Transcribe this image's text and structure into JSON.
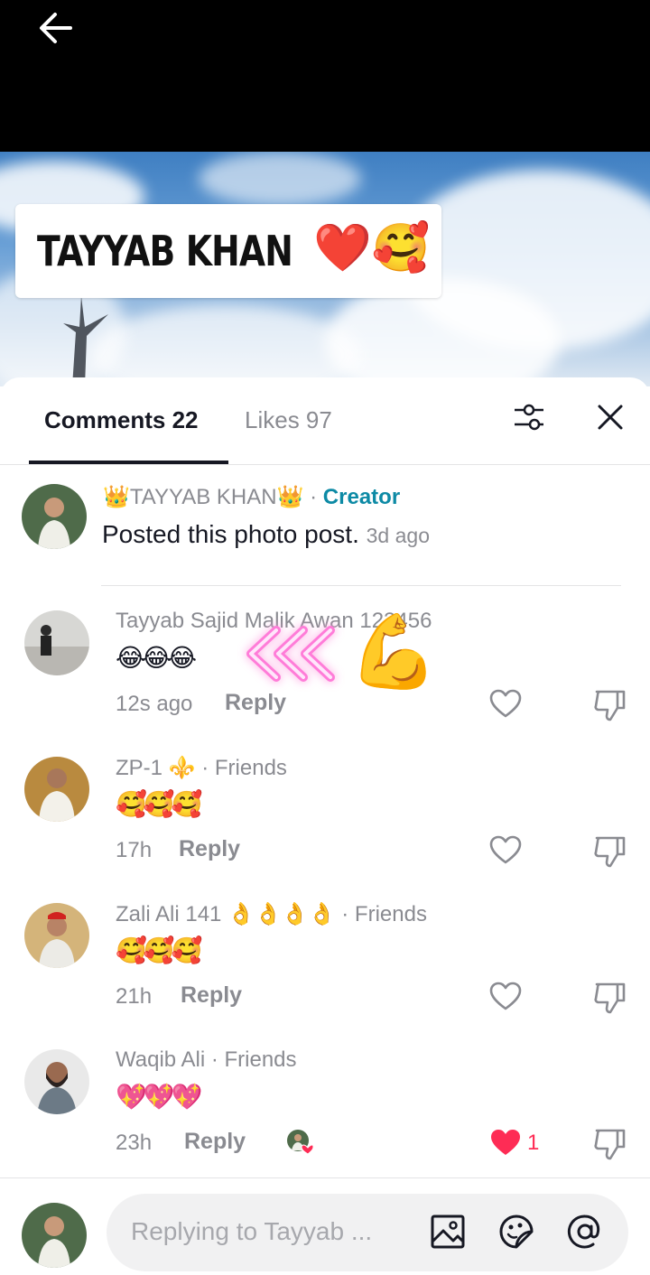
{
  "post": {
    "label_text": "TAYYAB KHAN",
    "label_emojis": "❤️🥰"
  },
  "tabs": {
    "comments": "Comments 22",
    "likes": "Likes 97"
  },
  "creator_post": {
    "name": "👑TAYYAB KHAN👑",
    "separator": " · ",
    "tag": "Creator",
    "text": "Posted this photo post.",
    "time": "3d ago"
  },
  "comments": [
    {
      "author": "Tayyab Sajid Malik Awan 123456",
      "text": "😂😂😂",
      "time": "12s ago",
      "reply": "Reply",
      "likes": ""
    },
    {
      "author": "ZP-1 ⚜️ · Friends",
      "text": "🥰🥰🥰",
      "time": "17h",
      "reply": "Reply",
      "likes": ""
    },
    {
      "author": "Zali  Ali  141  👌👌👌👌 · Friends",
      "text": "🥰🥰🥰",
      "time": "21h",
      "reply": "Reply",
      "likes": ""
    },
    {
      "author": "Waqib Ali · Friends",
      "text": "💖💖💖",
      "time": "23h",
      "reply": "Reply",
      "likes": "1"
    }
  ],
  "sticker": "💪",
  "composer": {
    "placeholder": "Replying to Tayyab ..."
  },
  "icons": {
    "back": "arrow-left-icon",
    "filter": "sliders-icon",
    "close": "close-icon",
    "like": "heart-outline-icon",
    "liked": "heart-filled-icon",
    "dislike": "thumbs-down-icon",
    "image": "image-icon",
    "sticker": "sticker-icon",
    "mention": "at-icon"
  },
  "colors": {
    "creator_tag": "#0d8aa5",
    "like_red": "#fe2c55",
    "text_primary": "#161823",
    "text_secondary": "#8a8b91"
  }
}
